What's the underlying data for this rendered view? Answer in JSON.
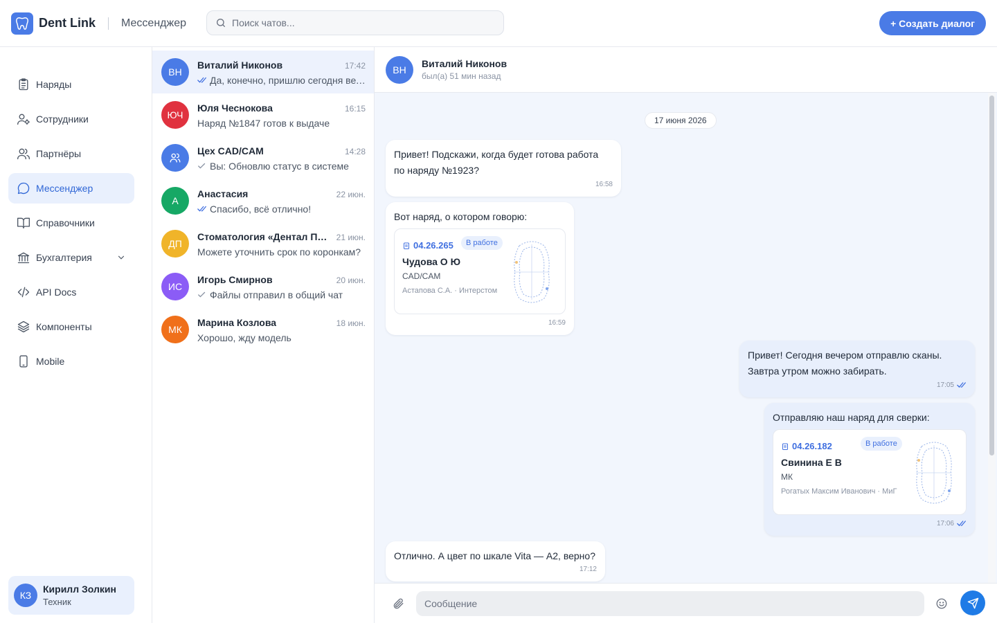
{
  "app": {
    "brand": "Dent Link",
    "section": "Мессенджер",
    "accent": "#4a7be6"
  },
  "search": {
    "placeholder": "Поиск чатов..."
  },
  "create_button": {
    "label": "+ Создать диалог"
  },
  "sidebar": {
    "items": [
      {
        "label": "Наряды",
        "icon": "clipboard-icon"
      },
      {
        "label": "Сотрудники",
        "icon": "user-settings-icon"
      },
      {
        "label": "Партнёры",
        "icon": "users-icon"
      },
      {
        "label": "Мессенджер",
        "icon": "chat-bubble-icon",
        "active": true
      },
      {
        "label": "Справочники",
        "icon": "book-icon"
      },
      {
        "label": "Бухгалтерия",
        "icon": "bank-icon",
        "expandable": true
      },
      {
        "label": "API Docs",
        "icon": "code-icon"
      },
      {
        "label": "Компоненты",
        "icon": "layers-icon"
      },
      {
        "label": "Mobile",
        "icon": "phone-icon"
      }
    ],
    "user": {
      "initials": "КЗ",
      "name": "Кирилл Золкин",
      "role": "Техник"
    }
  },
  "chats": [
    {
      "initials": "ВН",
      "name": "Виталий Никонов",
      "time": "17:42",
      "preview": "Да, конечно, пришлю сегодня вечером",
      "read": true,
      "color": "#4a7be6",
      "active": true
    },
    {
      "initials": "ЮЧ",
      "name": "Юля Чеснокова",
      "time": "16:15",
      "preview": "Наряд №1847 готов к выдаче",
      "color": "#e0323f"
    },
    {
      "initials": "",
      "group": true,
      "name": "Цех CAD/CAM",
      "time": "14:28",
      "preview": "Вы: Обновлю статус в системе",
      "sent": true,
      "color": "#4a7be6"
    },
    {
      "initials": "А",
      "name": "Анастасия",
      "time": "22 июн.",
      "preview": "Спасибо, всё отлично!",
      "read": true,
      "color": "#16a865"
    },
    {
      "initials": "ДП",
      "name": "Стоматология «Дентал Плюс»",
      "time": "21 июн.",
      "preview": "Можете уточнить срок по коронкам?",
      "color": "#f0b429"
    },
    {
      "initials": "ИС",
      "name": "Игорь Смирнов",
      "time": "20 июн.",
      "preview": "Файлы отправил в общий чат",
      "sent": true,
      "color": "#8b5cf6"
    },
    {
      "initials": "МК",
      "name": "Марина Козлова",
      "time": "18 июн.",
      "preview": "Хорошо, жду модель",
      "color": "#f0701a"
    }
  ],
  "conversation": {
    "initials": "ВН",
    "name": "Виталий Никонов",
    "status": "был(а) 51 мин назад",
    "date": "17 июня 2026",
    "messages": [
      {
        "dir": "in",
        "lines": [
          "Привет! Подскажи, когда будет готова работа",
          "по наряду №1923?"
        ],
        "time": "16:58"
      },
      {
        "dir": "in",
        "lines": [
          "Вот наряд, о котором говорю:"
        ],
        "time": "16:59",
        "order": {
          "number": "04.26.265",
          "status": "В работе",
          "patient": "Чудова О Ю",
          "type": "CAD/CAM",
          "meta": "Астапова С.А. · Интерстом"
        }
      },
      {
        "dir": "out",
        "lines": [
          "Привет! Сегодня вечером отправлю сканы.",
          "Завтра утром можно забирать."
        ],
        "time": "17:05"
      },
      {
        "dir": "out",
        "lines": [
          "Отправляю наш наряд для сверки:"
        ],
        "time": "17:06",
        "order": {
          "number": "04.26.182",
          "status": "В работе",
          "patient": "Свинина Е В",
          "type": "МК",
          "meta": "Рогатых Максим Иванович · МиГ"
        }
      },
      {
        "dir": "in",
        "lines": [
          "Отлично. А цвет по шкале Vita — А2, верно?"
        ],
        "time": "17:12"
      }
    ]
  },
  "composer": {
    "placeholder": "Сообщение"
  }
}
